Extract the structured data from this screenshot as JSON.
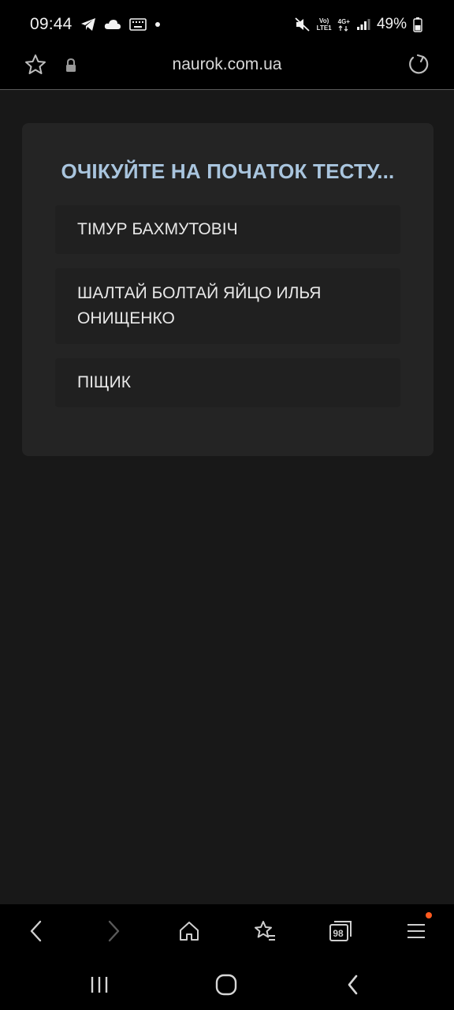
{
  "status_bar": {
    "time": "09:44",
    "left_icons": [
      "telegram-icon",
      "cloud-icon",
      "keyboard-icon",
      "dot-icon"
    ],
    "network_top": "Vo)",
    "network_bottom": "LTE1",
    "data_type": "4G+",
    "battery": "49%"
  },
  "address_bar": {
    "url": "naurok.com.ua"
  },
  "quiz_card": {
    "title": "ОЧІКУЙТЕ НА ПОЧАТОК ТЕСТУ...",
    "players": [
      "ТІМУР БАХМУТОВІЧ",
      "ШАЛТАЙ БОЛТАЙ ЯЙЦО ИЛЬЯ ОНИЩЕНКО",
      "ПІЩИК"
    ]
  },
  "browser_toolbar": {
    "tab_count": "98",
    "icons": [
      "back-icon",
      "forward-icon",
      "home-icon",
      "bookmarks-icon",
      "tabs-icon",
      "menu-icon"
    ]
  },
  "colors": {
    "title_accent": "#a9c5de",
    "card_bg": "#242424",
    "page_bg": "#181818",
    "notification_dot": "#ff5a1f"
  }
}
